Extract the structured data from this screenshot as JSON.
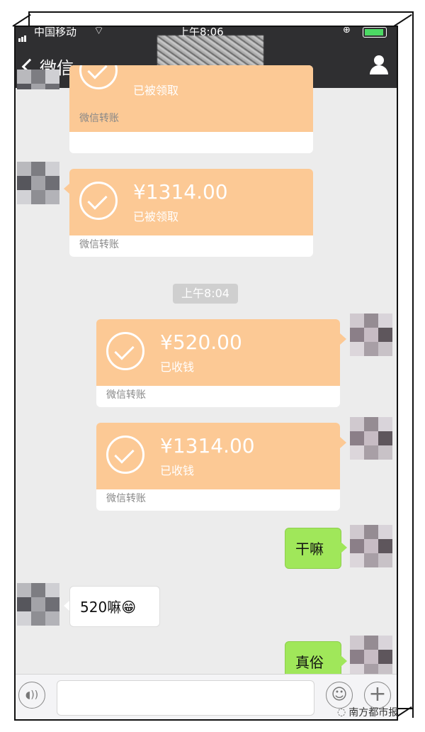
{
  "status_bar": {
    "carrier": "中国移动",
    "time": "上午8:06"
  },
  "nav": {
    "back_label": "微信"
  },
  "messages": {
    "card0": {
      "amount": "",
      "status": "已被领取",
      "footer": "微信转账"
    },
    "card1": {
      "amount": "¥1314.00",
      "status": "已被领取",
      "footer": "微信转账"
    },
    "timestamp": "上午8:04",
    "card2": {
      "amount": "¥520.00",
      "status": "已收钱",
      "footer": "微信转账"
    },
    "card3": {
      "amount": "¥1314.00",
      "status": "已收钱",
      "footer": "微信转账"
    },
    "text1": "干嘛",
    "text2": "520嘛",
    "text2_emoji": "😁",
    "text3": "真俗"
  },
  "watermark": "南方都市报",
  "colors": {
    "nav_bg": "#2f2f31",
    "transfer_card": "#fcc995",
    "sent_bubble": "#a0e75a",
    "chat_bg": "#ececec"
  },
  "icons": [
    "back-chevron-icon",
    "contact-icon",
    "check-circle-icon",
    "voice-icon",
    "emoji-icon",
    "plus-icon"
  ]
}
